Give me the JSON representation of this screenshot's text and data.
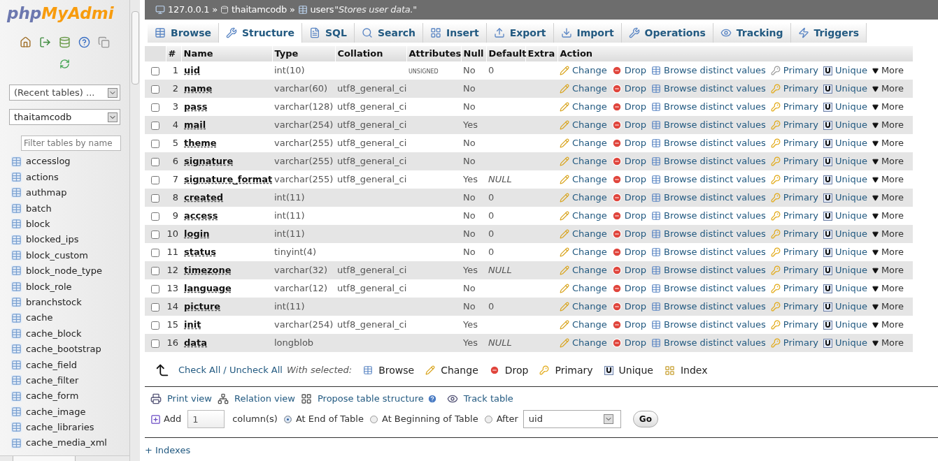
{
  "sidebar": {
    "logo_part1": "php",
    "logo_part2": "MyAdmi",
    "recent_tables": "(Recent tables) ...",
    "database": "thaitamcodb",
    "filter_placeholder": "Filter tables by name",
    "tables": [
      "accesslog",
      "actions",
      "authmap",
      "batch",
      "block",
      "blocked_ips",
      "block_custom",
      "block_node_type",
      "block_role",
      "branchstock",
      "cache",
      "cache_block",
      "cache_bootstrap",
      "cache_field",
      "cache_filter",
      "cache_form",
      "cache_image",
      "cache_libraries",
      "cache_media_xml"
    ]
  },
  "breadcrumb": {
    "separator": "»",
    "items": [
      "127.0.0.1",
      "thaitamcodb",
      "users"
    ],
    "comment": "\"Stores user data.\""
  },
  "tabs": [
    {
      "label": "Browse",
      "selected": false
    },
    {
      "label": "Structure",
      "selected": true
    },
    {
      "label": "SQL",
      "selected": false
    },
    {
      "label": "Search",
      "selected": false
    },
    {
      "label": "Insert",
      "selected": false
    },
    {
      "label": "Export",
      "selected": false
    },
    {
      "label": "Import",
      "selected": false
    },
    {
      "label": "Operations",
      "selected": false
    },
    {
      "label": "Tracking",
      "selected": false
    },
    {
      "label": "Triggers",
      "selected": false
    }
  ],
  "table": {
    "columns": [
      "#",
      "Name",
      "Type",
      "Collation",
      "Attributes",
      "Null",
      "Default",
      "Extra",
      "Action"
    ],
    "rows": [
      {
        "checked": false,
        "num": "1",
        "name": "uid",
        "type": "int(10)",
        "attributes": "UNSIGNED",
        "null": "No",
        "default": "0",
        "primary_available": false,
        "actions": [
          "Change",
          "Drop",
          "Browse distinct values",
          "Primary",
          "Unique",
          "More"
        ]
      },
      {
        "checked": false,
        "num": "2",
        "name": "name",
        "type": "varchar(60)",
        "collation": "utf8_general_ci",
        "null": "No",
        "primary_available": true,
        "actions": [
          "Change",
          "Drop",
          "Browse distinct values",
          "Primary",
          "Unique",
          "More"
        ]
      },
      {
        "checked": false,
        "num": "3",
        "name": "pass",
        "type": "varchar(128)",
        "collation": "utf8_general_ci",
        "null": "No",
        "primary_available": true,
        "actions": [
          "Change",
          "Drop",
          "Browse distinct values",
          "Primary",
          "Unique",
          "More"
        ]
      },
      {
        "checked": false,
        "num": "4",
        "name": "mail",
        "type": "varchar(254)",
        "collation": "utf8_general_ci",
        "null": "Yes",
        "primary_available": true,
        "actions": [
          "Change",
          "Drop",
          "Browse distinct values",
          "Primary",
          "Unique",
          "More"
        ]
      },
      {
        "checked": false,
        "num": "5",
        "name": "theme",
        "type": "varchar(255)",
        "collation": "utf8_general_ci",
        "null": "No",
        "primary_available": true,
        "actions": [
          "Change",
          "Drop",
          "Browse distinct values",
          "Primary",
          "Unique",
          "More"
        ]
      },
      {
        "checked": false,
        "num": "6",
        "name": "signature",
        "type": "varchar(255)",
        "collation": "utf8_general_ci",
        "null": "No",
        "primary_available": true,
        "actions": [
          "Change",
          "Drop",
          "Browse distinct values",
          "Primary",
          "Unique",
          "More"
        ]
      },
      {
        "checked": false,
        "num": "7",
        "name": "signature_format",
        "type": "varchar(255)",
        "collation": "utf8_general_ci",
        "null": "Yes",
        "default": "NULL",
        "default_null": true,
        "primary_available": true,
        "actions": [
          "Change",
          "Drop",
          "Browse distinct values",
          "Primary",
          "Unique",
          "More"
        ]
      },
      {
        "checked": false,
        "num": "8",
        "name": "created",
        "type": "int(11)",
        "null": "No",
        "default": "0",
        "primary_available": true,
        "actions": [
          "Change",
          "Drop",
          "Browse distinct values",
          "Primary",
          "Unique",
          "More"
        ]
      },
      {
        "checked": false,
        "num": "9",
        "name": "access",
        "type": "int(11)",
        "null": "No",
        "default": "0",
        "primary_available": true,
        "actions": [
          "Change",
          "Drop",
          "Browse distinct values",
          "Primary",
          "Unique",
          "More"
        ]
      },
      {
        "checked": false,
        "num": "10",
        "name": "login",
        "type": "int(11)",
        "null": "No",
        "default": "0",
        "primary_available": true,
        "actions": [
          "Change",
          "Drop",
          "Browse distinct values",
          "Primary",
          "Unique",
          "More"
        ]
      },
      {
        "checked": false,
        "num": "11",
        "name": "status",
        "type": "tinyint(4)",
        "null": "No",
        "default": "0",
        "primary_available": true,
        "actions": [
          "Change",
          "Drop",
          "Browse distinct values",
          "Primary",
          "Unique",
          "More"
        ]
      },
      {
        "checked": false,
        "num": "12",
        "name": "timezone",
        "type": "varchar(32)",
        "collation": "utf8_general_ci",
        "null": "Yes",
        "default": "NULL",
        "default_null": true,
        "primary_available": true,
        "actions": [
          "Change",
          "Drop",
          "Browse distinct values",
          "Primary",
          "Unique",
          "More"
        ]
      },
      {
        "checked": false,
        "num": "13",
        "name": "language",
        "type": "varchar(12)",
        "collation": "utf8_general_ci",
        "null": "No",
        "primary_available": true,
        "actions": [
          "Change",
          "Drop",
          "Browse distinct values",
          "Primary",
          "Unique",
          "More"
        ]
      },
      {
        "checked": false,
        "num": "14",
        "name": "picture",
        "type": "int(11)",
        "null": "No",
        "default": "0",
        "primary_available": true,
        "actions": [
          "Change",
          "Drop",
          "Browse distinct values",
          "Primary",
          "Unique",
          "More"
        ]
      },
      {
        "checked": false,
        "num": "15",
        "name": "init",
        "type": "varchar(254)",
        "collation": "utf8_general_ci",
        "null": "Yes",
        "primary_available": true,
        "actions": [
          "Change",
          "Drop",
          "Browse distinct values",
          "Primary",
          "Unique",
          "More"
        ]
      },
      {
        "checked": false,
        "num": "16",
        "name": "data",
        "type": "longblob",
        "null": "Yes",
        "default": "NULL",
        "default_null": true,
        "primary_available": true,
        "actions": [
          "Change",
          "Drop",
          "Browse distinct values",
          "Primary",
          "Unique",
          "More"
        ]
      }
    ]
  },
  "bulk": {
    "check_all": "Check All / Uncheck All",
    "with_selected": "With selected:",
    "actions": [
      "Browse",
      "Change",
      "Drop",
      "Primary",
      "Unique",
      "Index"
    ]
  },
  "links": [
    "Print view",
    "Relation view",
    "Propose table structure",
    "Track table"
  ],
  "add_column": {
    "label": "Add",
    "count": "1",
    "unit": "column(s)",
    "positions": [
      {
        "label": "At End of Table",
        "selected": true
      },
      {
        "label": "At Beginning of Table",
        "selected": false
      },
      {
        "label": "After",
        "selected": false
      }
    ],
    "after_field": "uid",
    "go": "Go"
  },
  "indexes": "+ Indexes"
}
